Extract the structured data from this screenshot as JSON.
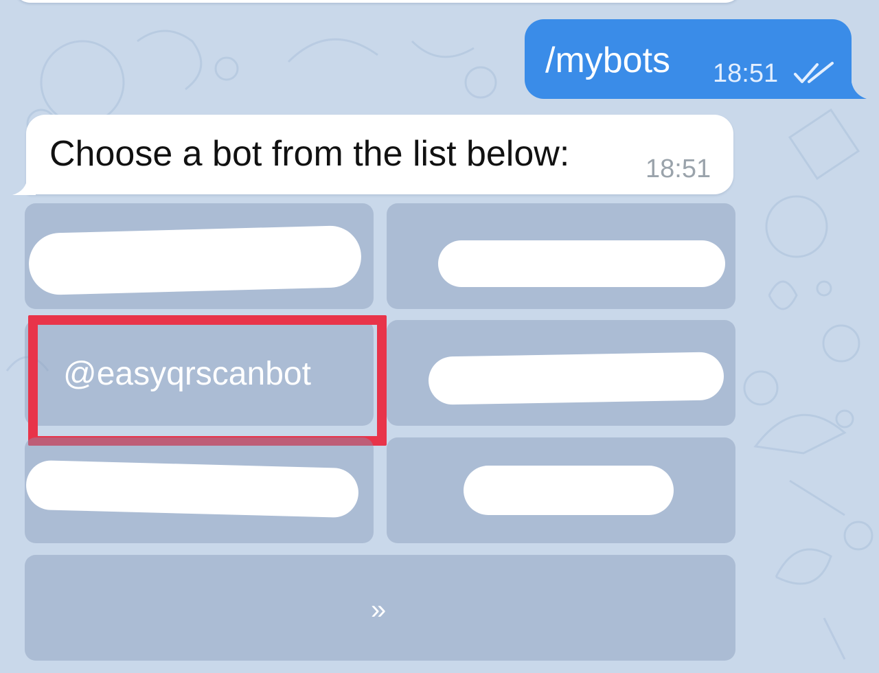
{
  "chat": {
    "outgoing": {
      "text": "/mybots",
      "time": "18:51",
      "status_icon": "double-check-icon"
    },
    "incoming": {
      "text": "Choose a bot from the list below:",
      "time": "18:51"
    }
  },
  "keyboard": {
    "buttons": [
      {
        "label": "",
        "redacted": true
      },
      {
        "label": "",
        "redacted": true
      },
      {
        "label": "@easyqrscanbot",
        "redacted": false,
        "highlighted": true
      },
      {
        "label": "",
        "redacted": true
      },
      {
        "label": "",
        "redacted": true
      },
      {
        "label": "",
        "redacted": true
      }
    ],
    "more_label": "»"
  },
  "colors": {
    "outgoing_bubble": "#3a8ce8",
    "highlight_border": "#e8344a",
    "background": "#c9d8ea"
  }
}
